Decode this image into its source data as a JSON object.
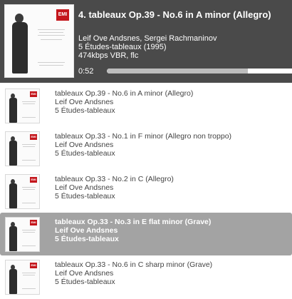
{
  "now_playing": {
    "title": "4. tableaux Op.39 - No.6 in A minor (Allegro)",
    "artists": "Leif Ove Andsnes, Sergei Rachmaninov",
    "album": "5 Études-tableaux (1995)",
    "format": "474kbps VBR, flc",
    "elapsed": "0:52",
    "progress_fraction": 0.76,
    "album_art": "album-cover-icon",
    "label_logo": "EMI"
  },
  "queue": [
    {
      "title": "tableaux Op.39 - No.6 in A minor (Allegro)",
      "artist": "Leif Ove Andsnes",
      "album": "5 Études-tableaux",
      "active": false
    },
    {
      "title": "tableaux Op.33 - No.1 in F minor (Allegro non troppo)",
      "artist": "Leif Ove Andsnes",
      "album": "5 Études-tableaux",
      "active": false
    },
    {
      "title": "tableaux Op.33 - No.2 in C (Allegro)",
      "artist": "Leif Ove Andsnes",
      "album": "5 Études-tableaux",
      "active": false
    },
    {
      "title": "tableaux Op.33 - No.3 in E flat minor (Grave)",
      "artist": "Leif Ove Andsnes",
      "album": "5 Études-tableaux",
      "active": true
    },
    {
      "title": "tableaux Op.33 - No.6 in C sharp minor (Grave)",
      "artist": "Leif Ove Andsnes",
      "album": "5 Études-tableaux",
      "active": false
    }
  ],
  "colors": {
    "header_bg": "#4a4a4a",
    "active_row_bg": "#a3a3a3",
    "emi_red": "#c4161c"
  }
}
